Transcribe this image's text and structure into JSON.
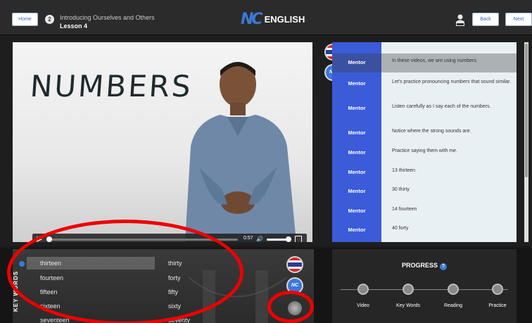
{
  "header": {
    "home_label": "Home",
    "lesson_number": "2",
    "lesson_title": "Introducing Ourselves and Others",
    "lesson_sub": "Lesson 4",
    "logo_mark": "NC",
    "logo_text": "ENGLISH",
    "back_label": "Back",
    "next_label": "Next"
  },
  "video": {
    "slide_word": "NUMBERS",
    "time": "0:57"
  },
  "flags": {
    "thai": "thai-flag-icon",
    "nc": "NC"
  },
  "transcript": [
    {
      "speaker": "Mentor",
      "text": "In these videos, we are using numbers."
    },
    {
      "speaker": "Mentor",
      "text": "Let's practice pronouncing numbers that sound similar."
    },
    {
      "speaker": "Mentor",
      "text": "Listen carefully as I say each of the numbers."
    },
    {
      "speaker": "Mentor",
      "text": "Notice where the strong sounds are."
    },
    {
      "speaker": "Mentor",
      "text": "Practice saying them with me."
    },
    {
      "speaker": "Mentor",
      "text": "13 thirteen"
    },
    {
      "speaker": "Mentor",
      "text": "30 thirty"
    },
    {
      "speaker": "Mentor",
      "text": "14 fourteen"
    },
    {
      "speaker": "Mentor",
      "text": "40 forty"
    }
  ],
  "keywords": {
    "label": "KEY WORDS",
    "left": [
      "thirteen",
      "fourteen",
      "fifteen",
      "sixteen",
      "seventeen"
    ],
    "right": [
      "thirty",
      "forty",
      "fifty",
      "sixty",
      "seventy"
    ]
  },
  "progress": {
    "title": "PROGRESS",
    "help": "?",
    "steps": [
      "Video",
      "Key Words",
      "Reading",
      "Practice"
    ]
  }
}
